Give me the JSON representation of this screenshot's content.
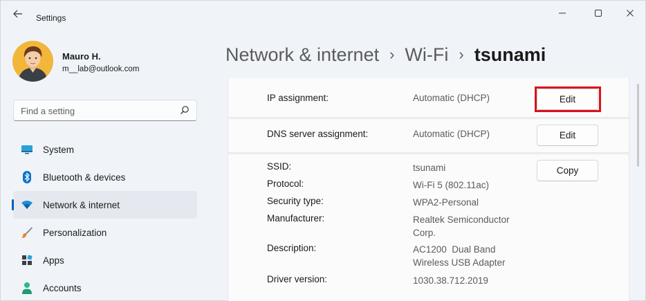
{
  "window": {
    "title": "Settings"
  },
  "profile": {
    "name": "Mauro H.",
    "email": "m__lab@outlook.com"
  },
  "search": {
    "placeholder": "Find a setting"
  },
  "nav": {
    "items": [
      {
        "label": "System",
        "icon": "monitor-icon"
      },
      {
        "label": "Bluetooth & devices",
        "icon": "bluetooth-icon"
      },
      {
        "label": "Network & internet",
        "icon": "wifi-icon",
        "active": true
      },
      {
        "label": "Personalization",
        "icon": "brush-icon"
      },
      {
        "label": "Apps",
        "icon": "apps-icon"
      },
      {
        "label": "Accounts",
        "icon": "person-icon"
      }
    ]
  },
  "breadcrumb": {
    "items": [
      "Network & internet",
      "Wi-Fi",
      "tsunami"
    ],
    "separator": "›"
  },
  "ip_assignment": {
    "label": "IP assignment:",
    "value": "Automatic (DHCP)",
    "button": "Edit"
  },
  "dns_assignment": {
    "label": "DNS server assignment:",
    "value": "Automatic (DHCP)",
    "button": "Edit"
  },
  "properties": {
    "copy_button": "Copy",
    "rows": [
      {
        "label": "SSID:",
        "value": "tsunami"
      },
      {
        "label": "Protocol:",
        "value": "Wi-Fi 5 (802.11ac)"
      },
      {
        "label": "Security type:",
        "value": "WPA2-Personal"
      },
      {
        "label": "Manufacturer:",
        "value": "Realtek Semiconductor Corp."
      },
      {
        "label": "Description:",
        "value": "AC1200  Dual Band Wireless USB Adapter"
      },
      {
        "label": "Driver version:",
        "value": "1030.38.712.2019"
      }
    ]
  },
  "colors": {
    "accent": "#005fb8",
    "highlight_box": "#d9121b",
    "window_bg": "#f0f4f9",
    "card_bg": "#fbfbfb"
  }
}
